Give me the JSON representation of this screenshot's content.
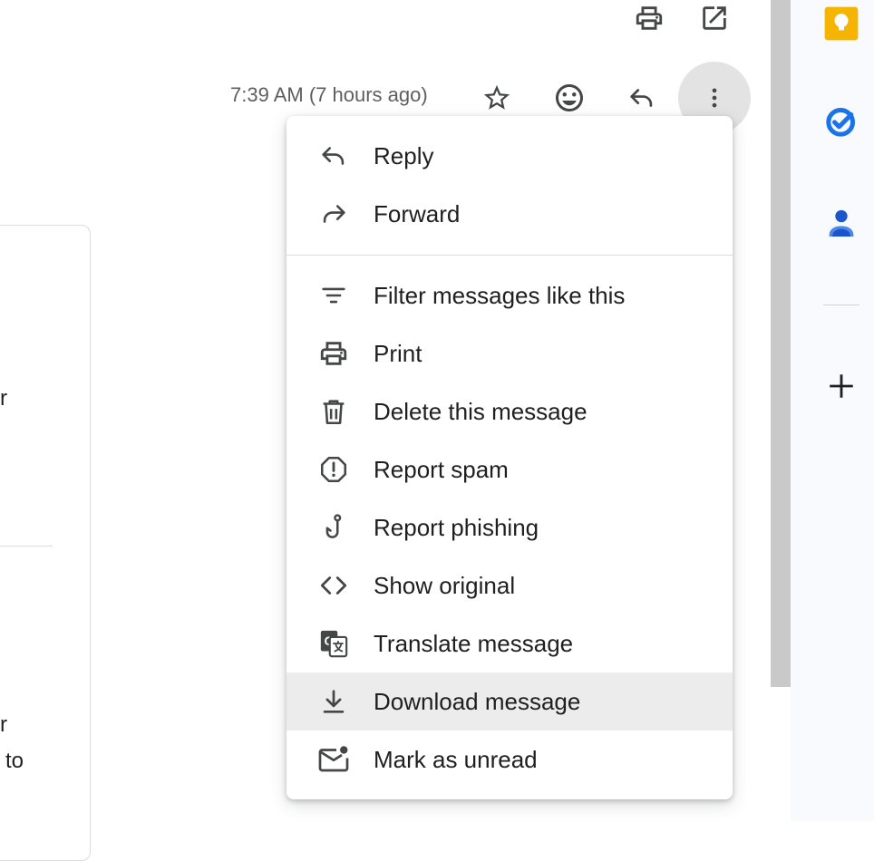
{
  "header": {
    "timestamp": "7:39 AM (7 hours ago)"
  },
  "left_fragments": [
    "r",
    "r",
    "to"
  ],
  "menu": {
    "items": [
      {
        "label": "Reply",
        "icon": "reply-icon"
      },
      {
        "label": "Forward",
        "icon": "forward-icon"
      },
      {
        "label": "Filter messages like this",
        "icon": "filter-icon"
      },
      {
        "label": "Print",
        "icon": "print-icon"
      },
      {
        "label": "Delete this message",
        "icon": "trash-icon"
      },
      {
        "label": "Report spam",
        "icon": "report-spam-icon"
      },
      {
        "label": "Report phishing",
        "icon": "fish-hook-icon"
      },
      {
        "label": "Show original",
        "icon": "code-icon"
      },
      {
        "label": "Translate message",
        "icon": "translate-icon"
      },
      {
        "label": "Download message",
        "icon": "download-icon",
        "highlighted": true
      },
      {
        "label": "Mark as unread",
        "icon": "mark-unread-icon"
      }
    ]
  },
  "side_panel": {
    "apps": [
      "keep-icon",
      "tasks-icon",
      "contacts-icon",
      "add-icon"
    ]
  },
  "colors": {
    "keep": "#F4B400",
    "tasks": "#1A73E8",
    "contacts": "#1A56C9",
    "menu_highlight": "#ECECEC",
    "icon": "#444746"
  }
}
